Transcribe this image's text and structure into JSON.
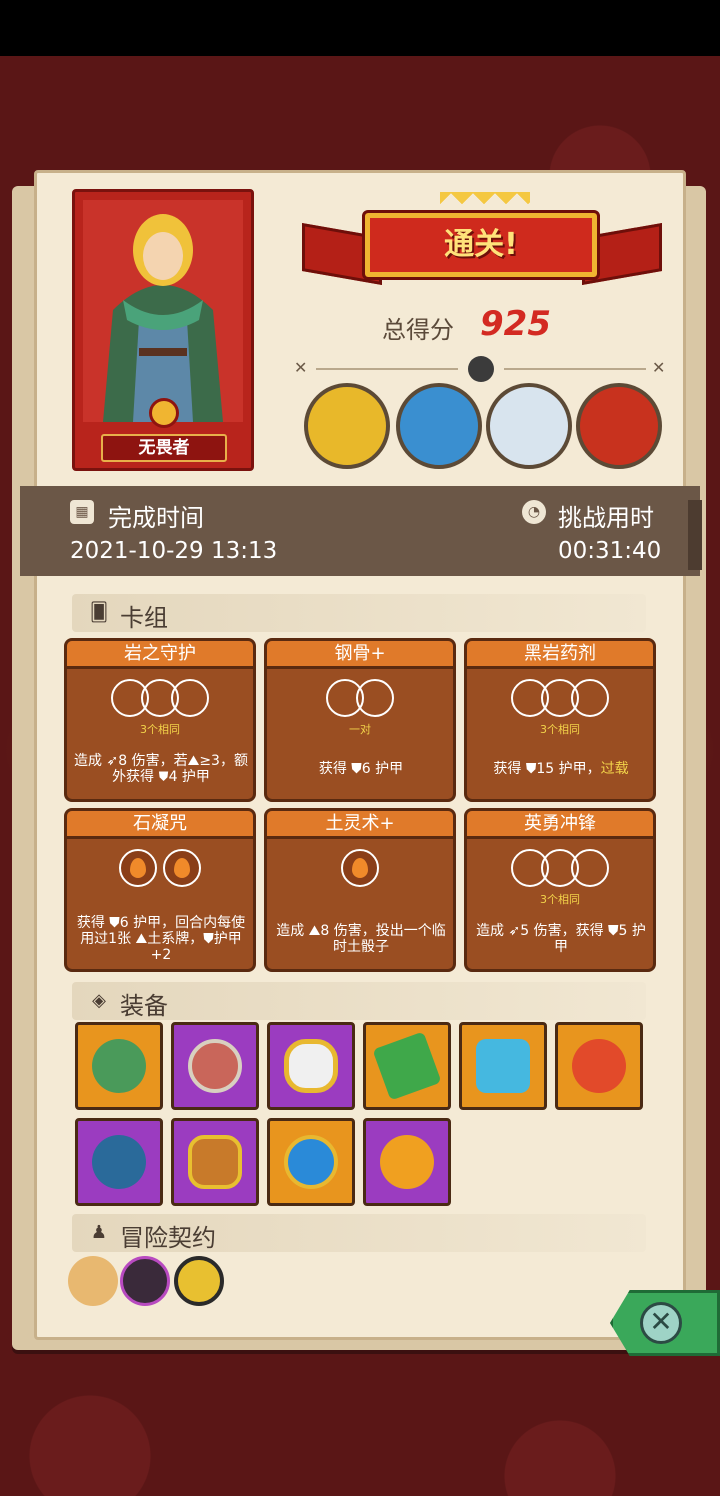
{
  "result": {
    "title": "通关!",
    "score_label": "总得分",
    "score_value": "925"
  },
  "hero": {
    "name": "无畏者"
  },
  "time": {
    "complete_label": "完成时间",
    "complete_value": "2021-10-29 13:13",
    "challenge_label": "挑战用时",
    "challenge_value": "00:31:40"
  },
  "deck": {
    "title": "卡组",
    "cards": [
      {
        "name": "岩之守护",
        "slots": 3,
        "slot_type": "empty",
        "sub": "3个相同",
        "desc": "造成 ➶8 伤害，若⛰≥3，额外获得 ⛊4 护甲"
      },
      {
        "name": "钢骨+",
        "slots": 2,
        "slot_type": "empty",
        "sub": "一对",
        "desc": "获得 ⛊6 护甲"
      },
      {
        "name": "黑岩药剂",
        "slots": 3,
        "slot_type": "empty",
        "sub": "3个相同",
        "desc_a": "获得 ⛊15 护甲，",
        "desc_b": "过载"
      },
      {
        "name": "石凝咒",
        "slots": 2,
        "slot_type": "fire",
        "sub": "",
        "desc": "获得 ⛊6 护甲，回合内每使用过1张 ⛰土系牌，⛊护甲+2"
      },
      {
        "name": "土灵术+",
        "slots": 1,
        "slot_type": "fire",
        "sub": "",
        "desc": "造成 ⛰8 伤害，投出一个临时土骰子"
      },
      {
        "name": "英勇冲锋",
        "slots": 3,
        "slot_type": "empty",
        "sub": "3个相同",
        "desc": "造成 ➶5 伤害，获得 ⛊5 护甲"
      }
    ]
  },
  "equipment": {
    "title": "装备",
    "items": [
      {
        "icon": "turtle-shell-icon",
        "color": "orange"
      },
      {
        "icon": "round-shield-icon",
        "color": "purple"
      },
      {
        "icon": "mirror-icon",
        "color": "purple"
      },
      {
        "icon": "moss-stone-icon",
        "color": "orange"
      },
      {
        "icon": "ice-crest-icon",
        "color": "orange"
      },
      {
        "icon": "meat-leg-icon",
        "color": "orange"
      },
      {
        "icon": "mask-helm-icon",
        "color": "purple"
      },
      {
        "icon": "rune-amulet-icon",
        "color": "purple"
      },
      {
        "icon": "water-orb-icon",
        "color": "orange"
      },
      {
        "icon": "fire-gem-icon",
        "color": "purple"
      }
    ]
  },
  "contracts": {
    "title": "冒险契约",
    "items": [
      {
        "icon": "scroll-icon"
      },
      {
        "icon": "campfire-icon"
      },
      {
        "icon": "gold-coin-icon"
      }
    ]
  },
  "colors": {
    "banner_red": "#cf2a1d",
    "score_red": "#d32a22",
    "card_brown": "#9a4e22",
    "card_header_orange": "#e07a2a",
    "rarity_orange": "#e8951e",
    "rarity_purple": "#9b3cc0",
    "close_green": "#3aa85a"
  }
}
